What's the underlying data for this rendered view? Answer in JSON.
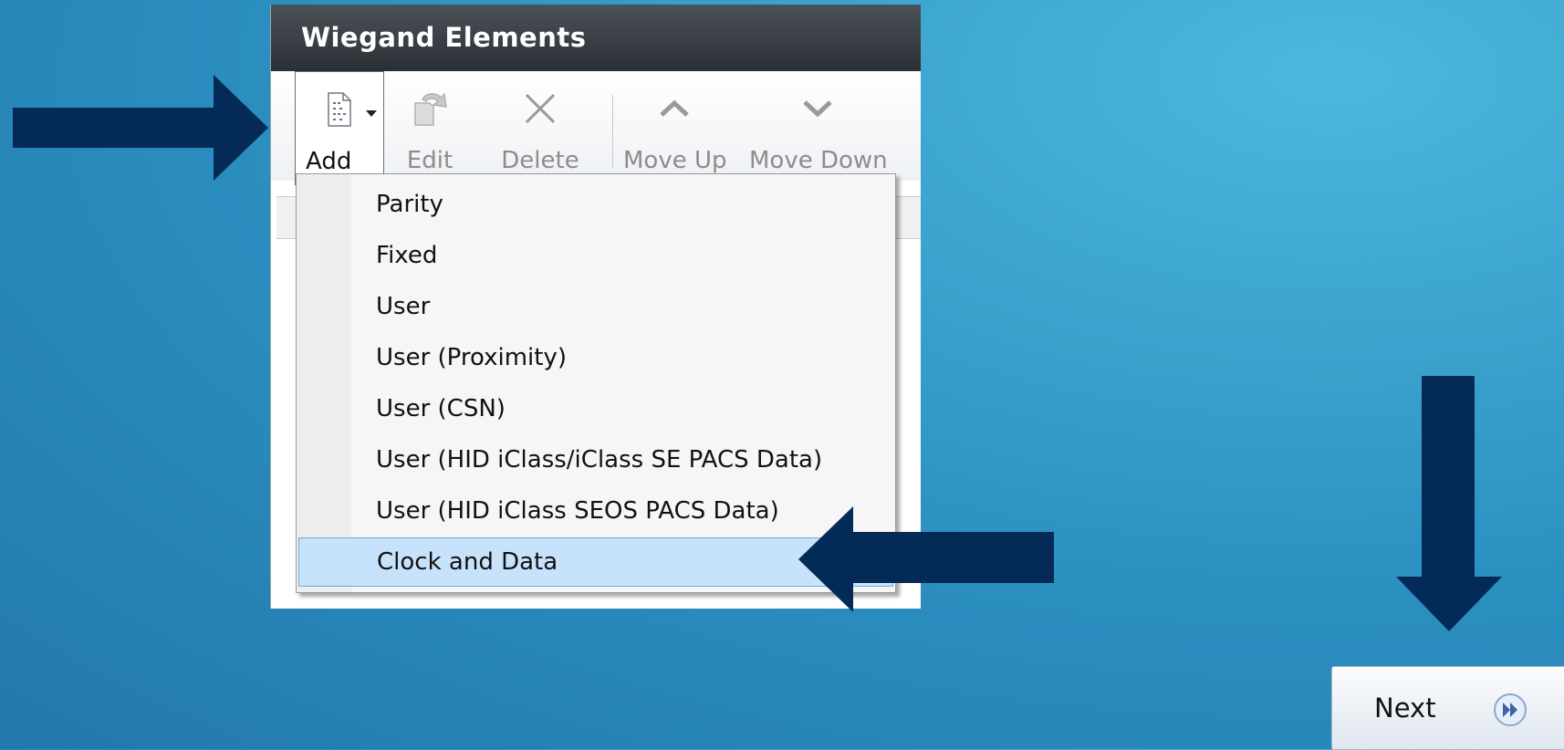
{
  "window": {
    "title": "Wiegand Elements"
  },
  "toolbar": {
    "add_label": "Add",
    "edit_label": "Edit",
    "delete_label": "Delete",
    "move_up_label": "Move Up",
    "move_down_label": "Move Down"
  },
  "add_menu": {
    "items": [
      {
        "label": "Parity"
      },
      {
        "label": "Fixed"
      },
      {
        "label": "User"
      },
      {
        "label": "User (Proximity)"
      },
      {
        "label": "User (CSN)"
      },
      {
        "label": "User (HID iClass/iClass SE PACS Data)"
      },
      {
        "label": "User (HID iClass SEOS PACS Data)"
      },
      {
        "label": "Clock and Data",
        "selected": true
      }
    ]
  },
  "next_button": {
    "label": "Next"
  },
  "colors": {
    "arrow": "#042b57",
    "selection": "#c7e3fb",
    "titlebar": "#2f353a"
  },
  "icons": [
    "add-file-icon",
    "edit-icon",
    "delete-x-icon",
    "move-up-chevron-icon",
    "move-down-chevron-icon",
    "fast-forward-icon"
  ]
}
